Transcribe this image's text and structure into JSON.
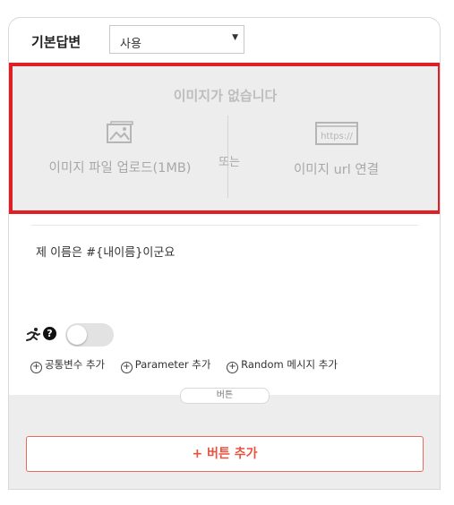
{
  "header": {
    "title": "기본답변",
    "select_value": "사용"
  },
  "image_area": {
    "title": "이미지가 없습니다",
    "upload_label": "이미지 파일 업로드(1MB)",
    "or_label": "또는",
    "url_icon_text": "https://",
    "url_label": "이미지 url 연결"
  },
  "message": {
    "text": "제 이름은 #{내이름}이군요"
  },
  "links": {
    "common_var": "공통변수 추가",
    "parameter": "Parameter 추가",
    "random_msg": "Random 메시지 추가"
  },
  "button_section": {
    "tab_label": "버튼",
    "add_button_label": "+ 버튼 추가"
  },
  "colors": {
    "accent": "#e8523f",
    "highlight_border": "#e01e26"
  }
}
